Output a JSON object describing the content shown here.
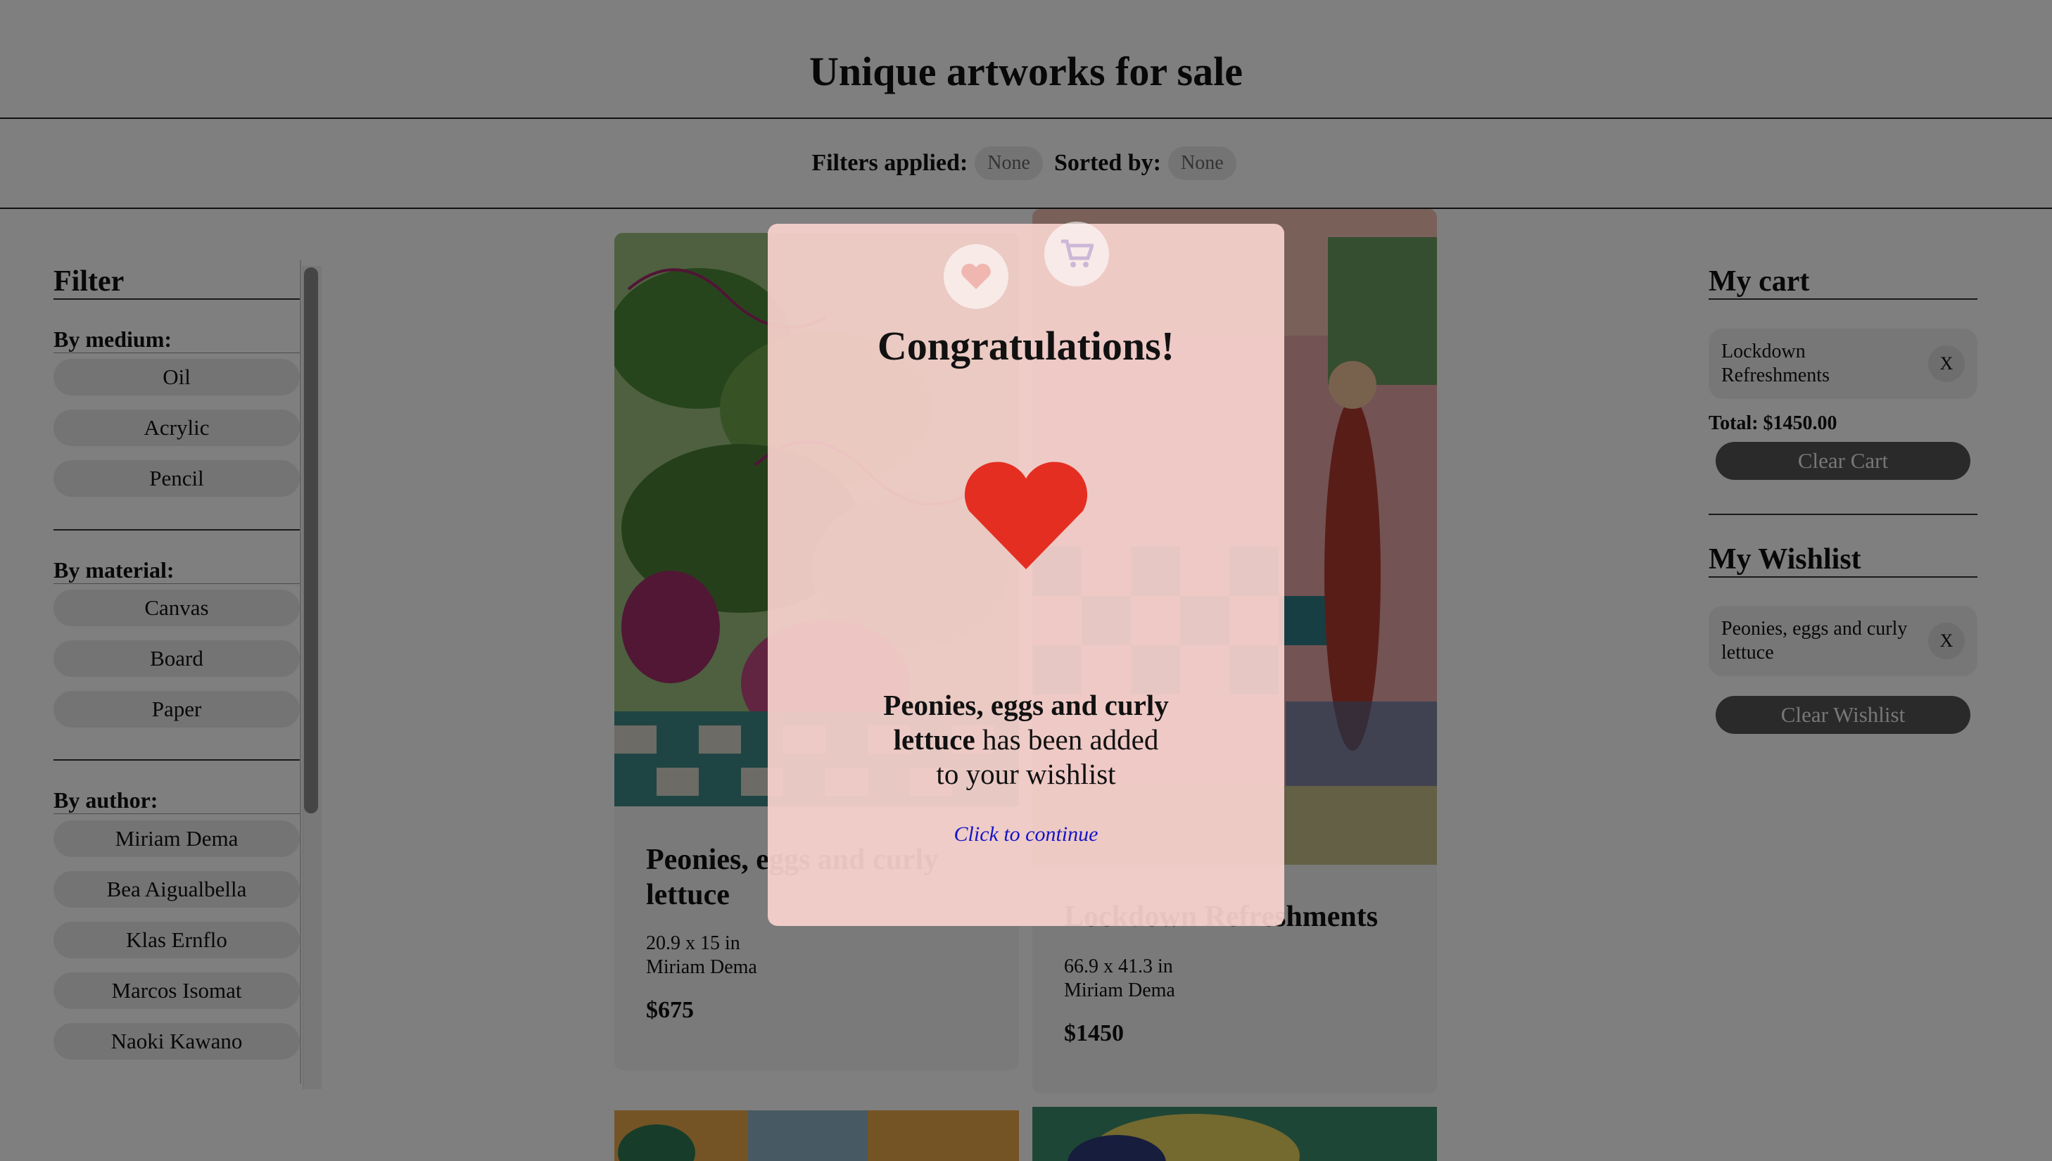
{
  "header": {
    "title": "Unique artworks for sale"
  },
  "filter_bar": {
    "filters_label": "Filters applied:",
    "filters_value": "None",
    "sorted_label": "Sorted by:",
    "sorted_value": "None"
  },
  "sidebar": {
    "title": "Filter",
    "medium": {
      "heading": "By medium:",
      "items": [
        "Oil",
        "Acrylic",
        "Pencil"
      ]
    },
    "material": {
      "heading": "By material:",
      "items": [
        "Canvas",
        "Board",
        "Paper"
      ]
    },
    "author": {
      "heading": "By author:",
      "items": [
        "Miriam Dema",
        "Bea Aigualbella",
        "Klas Ernflo",
        "Marcos Isomat",
        "Naoki Kawano"
      ]
    }
  },
  "artworks": [
    {
      "title_line1": "Peonies, eggs and curly",
      "title_line2": "lettuce",
      "size": "20.9 x 15 in",
      "author": "Miriam Dema",
      "price": "$675"
    },
    {
      "title": "Lockdown Refreshments",
      "size": "66.9 x 41.3 in",
      "author": "Miriam Dema",
      "price": "$1450"
    }
  ],
  "cart": {
    "title": "My cart",
    "items": [
      {
        "line1": "Lockdown",
        "line2": "Refreshments",
        "remove": "X"
      }
    ],
    "total": "Total: $1450.00",
    "clear_label": "Clear Cart"
  },
  "wishlist": {
    "title": "My Wishlist",
    "items": [
      {
        "line1": "Peonies, eggs and curly",
        "line2": "lettuce",
        "remove": "X"
      }
    ],
    "clear_label": "Clear Wishlist"
  },
  "modal": {
    "title": "Congratulations!",
    "item_line1": "Peonies, eggs and curly",
    "item_line2": "lettuce",
    "message_line2": " has been added",
    "message_line3": "to your wishlist",
    "continue": "Click to continue"
  },
  "colors": {
    "heart": "#e52e22",
    "modal_bg": "#f7d2ce",
    "link": "#1414c8",
    "overlay": "rgba(0,0,0,0.5)"
  },
  "icons": [
    "heart-icon",
    "cart-icon"
  ]
}
